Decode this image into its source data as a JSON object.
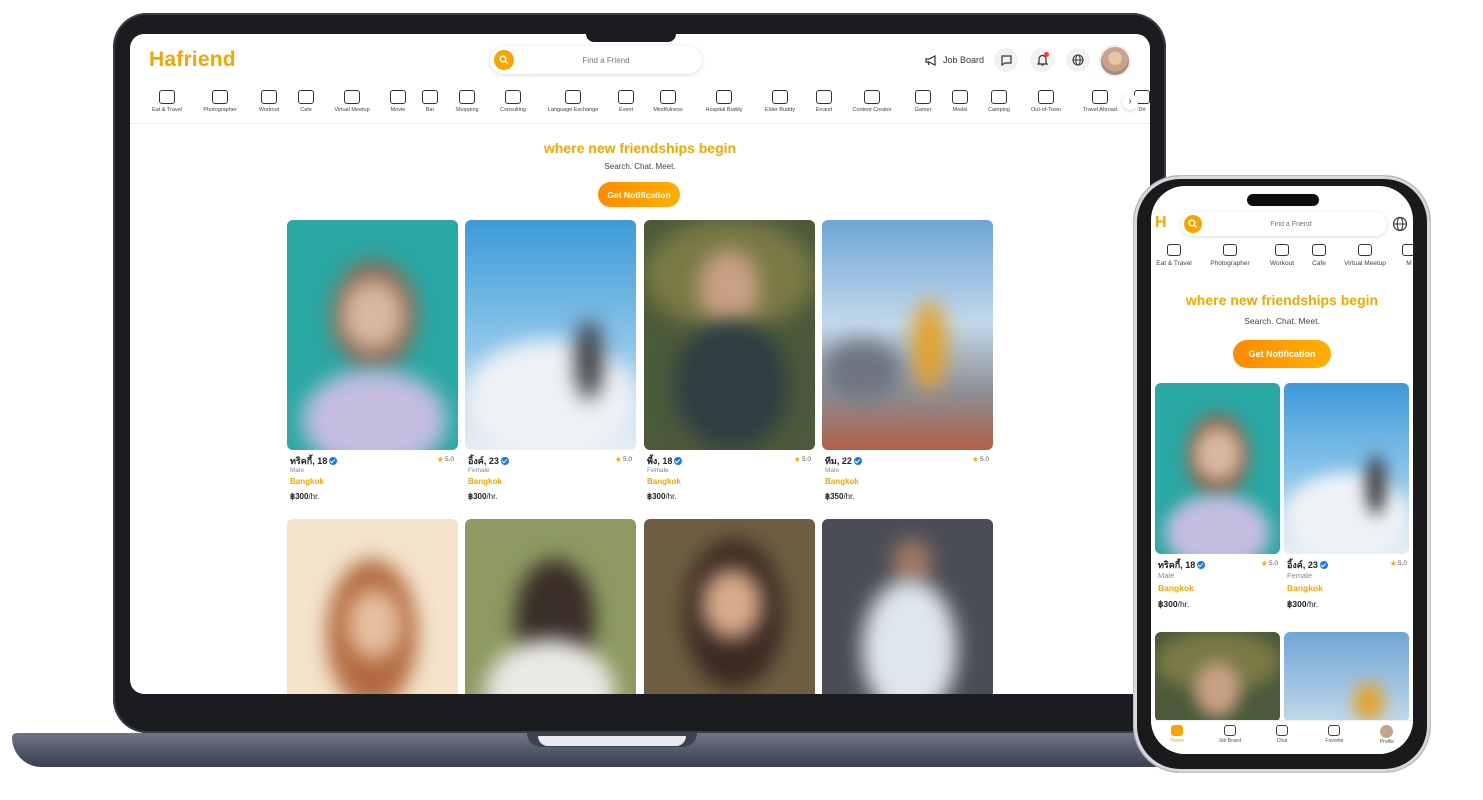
{
  "brand": {
    "logo_text": "Hafriend",
    "logo_short": "H",
    "accent": "#f7a600"
  },
  "search": {
    "placeholder": "Find a Friend"
  },
  "header": {
    "job_board": "Job Board",
    "icons": [
      "megaphone-icon",
      "chat-icon",
      "bell-icon",
      "globe-icon"
    ]
  },
  "categories": [
    "Eat & Travel",
    "Photographer",
    "Workout",
    "Cafe",
    "Virtual Meetup",
    "Movie",
    "Bar",
    "Shopping",
    "Consulting",
    "Language Exchange",
    "Event",
    "Mindfulness",
    "Hospital Buddy",
    "Elder Buddy",
    "Errand",
    "Content Creator",
    "Gamer",
    "Model",
    "Camping",
    "Out-of-Town",
    "Travel Abroad",
    "Dri"
  ],
  "mobile_categories": [
    "Eat & Travel",
    "Photographer",
    "Workout",
    "Cafe",
    "Virtual Meetup",
    "M"
  ],
  "hero": {
    "tagline": "where new friendships begin",
    "subtitle": "Search. Chat. Meet.",
    "cta": "Get Notification"
  },
  "profiles": [
    {
      "name": "ทริคกี้, 18",
      "rating": "5.0",
      "gender": "Male",
      "city": "Bangkok",
      "price": "฿300",
      "unit": "/hr."
    },
    {
      "name": "อิ้งค์, 23",
      "rating": "5.0",
      "gender": "Female",
      "city": "Bangkok",
      "price": "฿300",
      "unit": "/hr."
    },
    {
      "name": "พี้ง, 18",
      "rating": "5.0",
      "gender": "Female",
      "city": "Bangkok",
      "price": "฿300",
      "unit": "/hr."
    },
    {
      "name": "ทีม, 22",
      "rating": "5.0",
      "gender": "Male",
      "city": "Bangkok",
      "price": "฿350",
      "unit": "/hr."
    }
  ],
  "bottom_nav": [
    "Home",
    "Job Board",
    "Chat",
    "Favorite",
    "Profile"
  ]
}
